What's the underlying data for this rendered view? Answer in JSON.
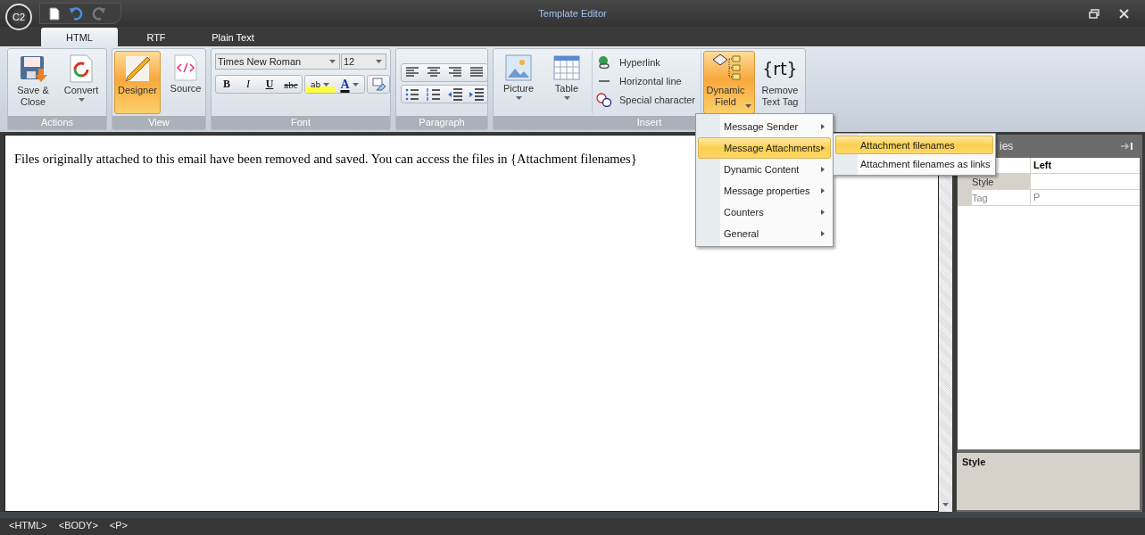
{
  "window": {
    "title": "Template Editor",
    "logo_text": "C2"
  },
  "tabs": [
    {
      "label": "HTML",
      "selected": true
    },
    {
      "label": "RTF",
      "selected": false
    },
    {
      "label": "Plain Text",
      "selected": false
    }
  ],
  "ribbon": {
    "groups": [
      {
        "label": "Actions",
        "kind": "buttons",
        "items": [
          {
            "label": "Save &\nClose",
            "kind": "save",
            "selected": false
          },
          {
            "label": "Convert",
            "kind": "convert",
            "dropdown": true,
            "selected": false
          }
        ]
      },
      {
        "label": "View",
        "kind": "buttons",
        "items": [
          {
            "label": "Designer",
            "kind": "designer",
            "selected": true
          },
          {
            "label": "Source",
            "kind": "source",
            "selected": false
          }
        ]
      },
      {
        "label": "Font",
        "kind": "font",
        "font_name": "Times New Roman",
        "font_size": "12",
        "format": [
          {
            "glyph": "B",
            "kind": "bold"
          },
          {
            "glyph": "I",
            "kind": "italic"
          },
          {
            "glyph": "U",
            "kind": "underline"
          },
          {
            "glyph": "abc",
            "kind": "strike"
          }
        ],
        "highlight_glyph": "ab",
        "color_glyph": "A"
      },
      {
        "label": "Paragraph",
        "kind": "paragraph"
      },
      {
        "label": "Insert",
        "kind": "insert",
        "items": [
          {
            "label": "Picture",
            "kind": "picture",
            "dropdown": true
          },
          {
            "label": "Table",
            "kind": "table",
            "dropdown": true
          }
        ],
        "links": [
          {
            "label": "Hyperlink",
            "kind": "link"
          },
          {
            "label": "Horizontal line",
            "kind": "line"
          },
          {
            "label": "Special character",
            "kind": "special"
          }
        ],
        "dynamic": {
          "label": "Dynamic\nField",
          "expanded": true
        },
        "remove": {
          "label": "Remove\nText Tag",
          "icon_text": "{rt}"
        }
      }
    ]
  },
  "editor": {
    "text": "Files originally attached to this email have been removed and saved. You can access the files in {Attachment filenames}"
  },
  "properties": {
    "title": "ies",
    "rows": [
      {
        "name": "",
        "value": "Left",
        "selected": false
      },
      {
        "name": "Style",
        "value": "",
        "selected": true
      },
      {
        "name": "Tag",
        "value": "P",
        "selected": false
      }
    ],
    "description_title": "Style"
  },
  "menu": {
    "items": [
      {
        "label": "Message Sender",
        "selected": false
      },
      {
        "label": "Message Attachments",
        "selected": true
      },
      {
        "label": "Dynamic Content",
        "selected": false
      },
      {
        "label": "Message properties",
        "selected": false
      },
      {
        "label": "Counters",
        "selected": false
      },
      {
        "label": "General",
        "selected": false
      }
    ]
  },
  "submenu": {
    "items": [
      {
        "label": "Attachment filenames",
        "selected": true
      },
      {
        "label": "Attachment filenames as links",
        "selected": false
      }
    ]
  },
  "status_bar": {
    "tags": [
      "<HTML>",
      "<BODY>",
      "<P>"
    ]
  }
}
